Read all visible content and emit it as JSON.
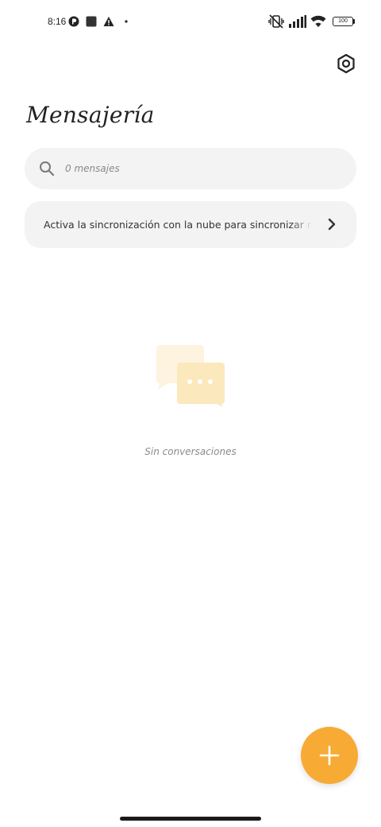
{
  "status_bar": {
    "time": "8:16",
    "battery_level": "100",
    "icons": [
      "app-badge-icon",
      "app-square-icon",
      "warning-icon",
      "dot-icon",
      "vibrate-off-icon",
      "signal-icon",
      "wifi-icon",
      "battery-icon"
    ]
  },
  "header": {
    "title": "Mensajería",
    "settings_icon": "settings-hex-icon"
  },
  "search": {
    "placeholder": "0 mensajes",
    "icon": "search-icon"
  },
  "sync_banner": {
    "text": "Activa la sincronización con la nube para sincronizar mensajes",
    "icon": "chevron-right-icon"
  },
  "empty_state": {
    "text": "Sin conversaciones",
    "icon": "chat-bubbles-icon"
  },
  "fab": {
    "icon": "plus-icon",
    "color": "#f7ab35"
  },
  "colors": {
    "accent": "#f7ab35",
    "surface": "#f3f3f3",
    "bubble_back": "#fdf3df",
    "bubble_front": "#fbe8bd"
  }
}
